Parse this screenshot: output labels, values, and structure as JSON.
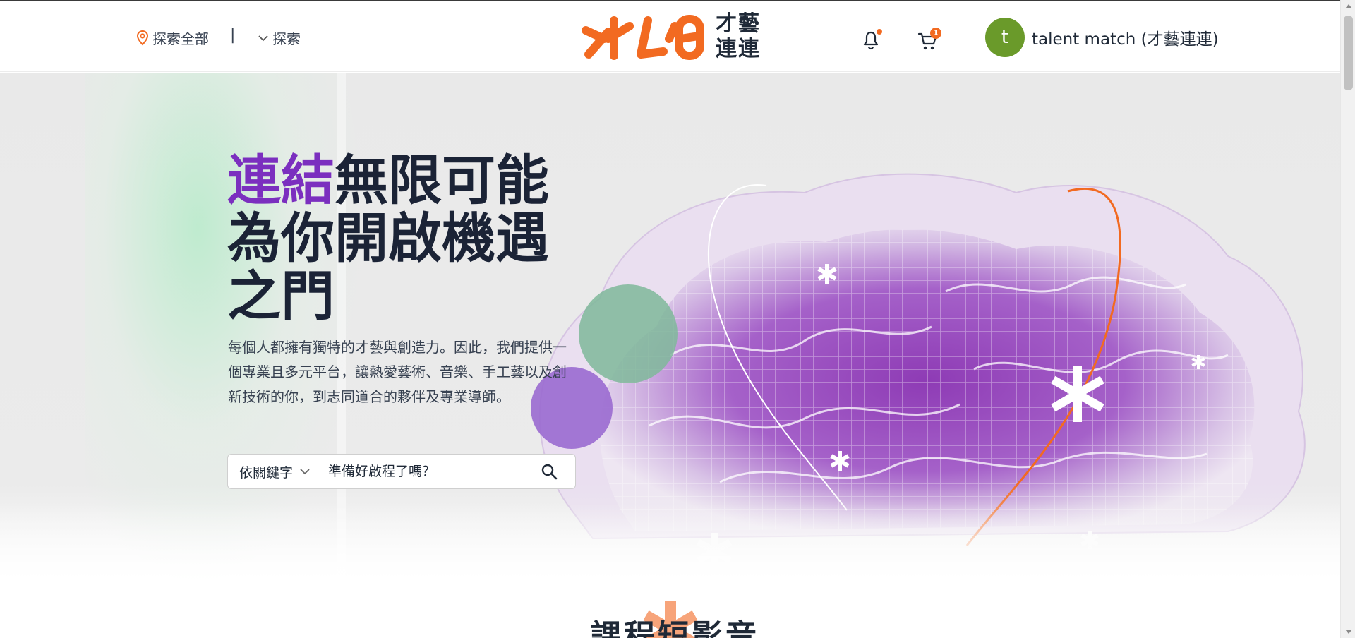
{
  "header": {
    "location_label": "探索全部",
    "divider": "|",
    "explore_label": "探索",
    "logo_text_line1": "才藝",
    "logo_text_line2": "連連",
    "cart_count": "1",
    "user_initial": "t",
    "user_name": "talent match (才藝連連)"
  },
  "hero": {
    "title_accent": "連結",
    "title_line1_rest": "無限可能",
    "title_line2": "為你開啟機遇",
    "title_line3": "之門",
    "description": "每個人都擁有獨特的才藝與創造力。因此，我們提供一個專業且多元平台，讓熱愛藝術、音樂、手工藝以及創新技術的你，到志同道合的夥伴及專業導師。",
    "search_type": "依關鍵字",
    "search_placeholder": "準備好啟程了嗎？"
  },
  "section": {
    "title": "課程短影音"
  },
  "colors": {
    "brand_orange": "#f26a21",
    "accent_purple": "#7b2fbf",
    "avatar_green": "#6a9a2a",
    "title_dark": "#1b2336"
  },
  "icons": {
    "location": "location-pin-icon",
    "explore": "chevron-down-icon",
    "notifications": "bell-icon",
    "cart": "cart-icon",
    "search": "search-icon"
  }
}
